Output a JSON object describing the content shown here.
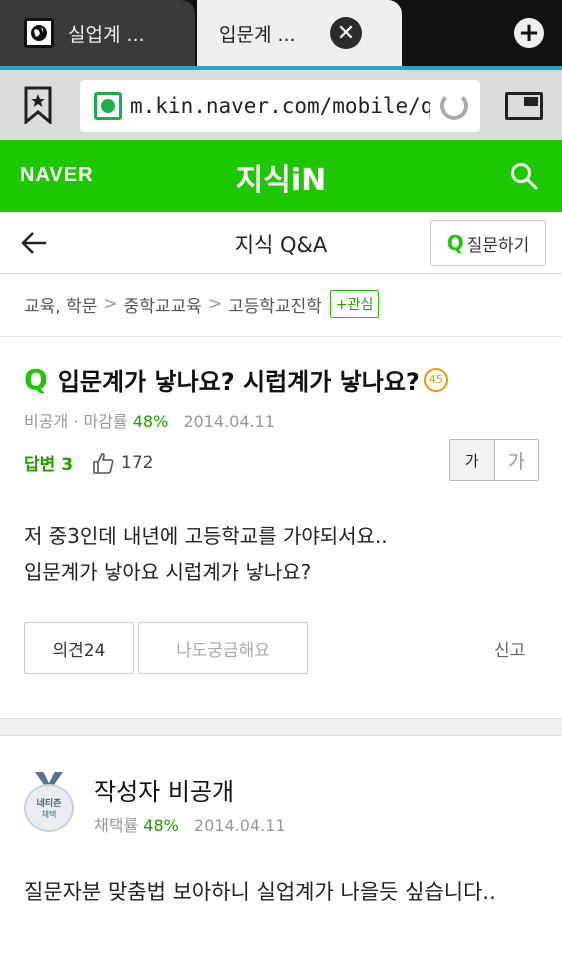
{
  "browser": {
    "tabs": [
      {
        "title": "실업계 ...",
        "icon": "globe-icon"
      },
      {
        "title": "입문계 ...",
        "icon": "close-icon"
      }
    ],
    "new_tab_symbol": "+",
    "close_symbol": "✕",
    "url": "m.kin.naver.com/mobile/qna",
    "accent_color": "#2aa3c6"
  },
  "site": {
    "logo": "NAVER",
    "title": "지식iN",
    "brand_color": "#1ec800"
  },
  "subheader": {
    "title": "지식 Q&A",
    "ask_q": "Q",
    "ask_label": "질문하기"
  },
  "breadcrumb": {
    "items": [
      "교육, 학문",
      "중학교교육",
      "고등학교진학"
    ],
    "separator": ">",
    "interest_label": "+관심"
  },
  "question": {
    "q_mark": "Q",
    "title": "입문계가 낳나요? 시럽계가 낳나요?",
    "points": "45",
    "author": "비공개",
    "close_rate_label": "· 마감률",
    "close_rate": "48%",
    "date": "2014.04.11",
    "answers_label": "답변 3",
    "likes": "172",
    "font_small": "가",
    "font_large": "가",
    "body_lines": [
      " 저 중3인데 내년에 고등학교를 가야되서요..",
      "입문계가 낳아요 시럽계가 낳나요?"
    ],
    "opinion_label": "의견24",
    "curious_label": "나도궁금해요",
    "report_label": "신고"
  },
  "answer": {
    "medal_line1": "네티즌",
    "medal_line2": "채택",
    "author": "작성자 비공개",
    "adopt_label": "채택률",
    "adopt_rate": "48%",
    "date": "2014.04.11",
    "body": " 질문자분 맞춤법 보아하니 실업계가 나을듯 싶습니다.."
  }
}
